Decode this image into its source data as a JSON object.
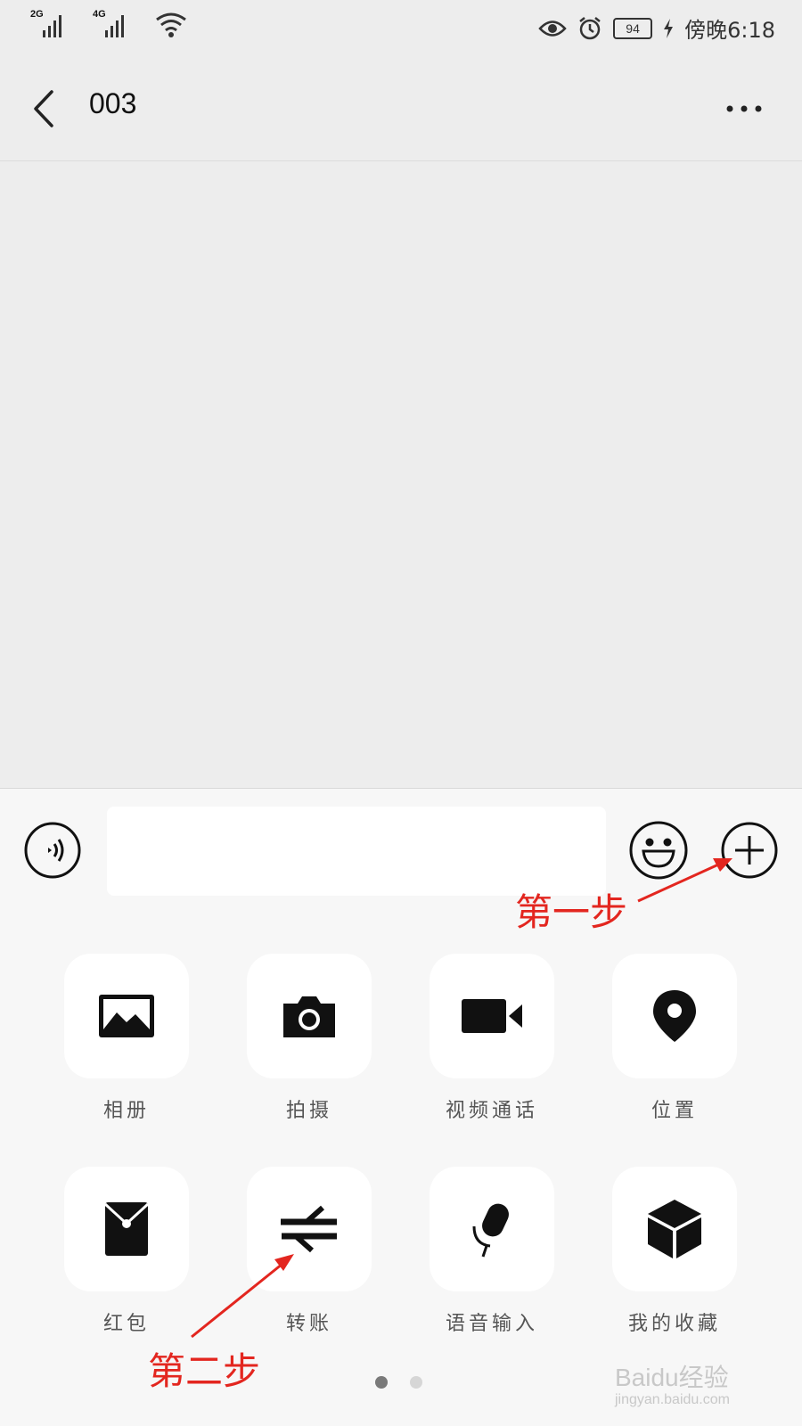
{
  "status_bar": {
    "signal1_label": "2G",
    "signal2_label": "4G",
    "battery_level": "94",
    "time": "傍晚6:18"
  },
  "header": {
    "title": "003"
  },
  "apps": [
    {
      "label": "相册",
      "icon": "photo-icon"
    },
    {
      "label": "拍摄",
      "icon": "camera-icon"
    },
    {
      "label": "视频通话",
      "icon": "video-call-icon"
    },
    {
      "label": "位置",
      "icon": "location-icon"
    },
    {
      "label": "红包",
      "icon": "red-packet-icon"
    },
    {
      "label": "转账",
      "icon": "transfer-icon"
    },
    {
      "label": "语音输入",
      "icon": "microphone-icon"
    },
    {
      "label": "我的收藏",
      "icon": "favorites-cube-icon"
    }
  ],
  "annotations": {
    "step1": "第一步",
    "step2": "第二步"
  },
  "watermark": {
    "brand": "Baidu经验",
    "url": "jingyan.baidu.com"
  },
  "colors": {
    "annotation": "#e3261f",
    "page_dot_active": "#7a7a7a",
    "page_dot_inactive": "#d6d6d6"
  }
}
